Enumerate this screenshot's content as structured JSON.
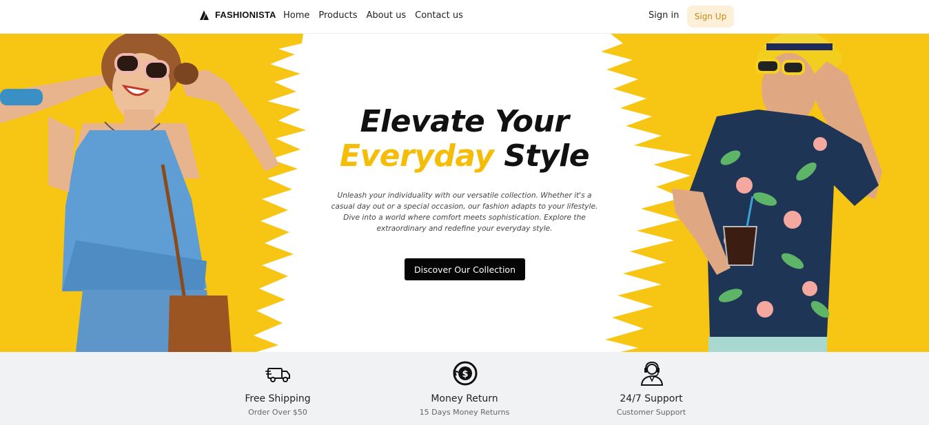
{
  "nav": {
    "brand": "FASHIONISTA",
    "links": [
      "Home",
      "Products",
      "About us",
      "Contact us"
    ],
    "signin": "Sign in",
    "signup": "Sign Up"
  },
  "hero": {
    "title_line1": "Elevate Your",
    "title_accent": "Everyday",
    "title_rest": " Style",
    "description": "Unleash your individuality with our versatile collection. Whether it's a casual day out or a special occasion, our fashion adapts to your lifestyle. Dive into a world where comfort meets sophistication. Explore the extraordinary and redefine your everyday style.",
    "cta": "Discover Our Collection"
  },
  "features": [
    {
      "icon": "delivery-truck-icon",
      "title": "Free Shipping",
      "subtitle": "Order Over $50"
    },
    {
      "icon": "money-return-icon",
      "title": "Money Return",
      "subtitle": "15 Days Money Returns"
    },
    {
      "icon": "support-agent-icon",
      "title": "24/7 Support",
      "subtitle": "Customer Support"
    }
  ],
  "colors": {
    "accent": "#f5bd07",
    "signup_bg": "#fdf0d9",
    "signup_text": "#c78a12",
    "cta_bg": "#050505",
    "features_bg": "#f1f2f4"
  }
}
